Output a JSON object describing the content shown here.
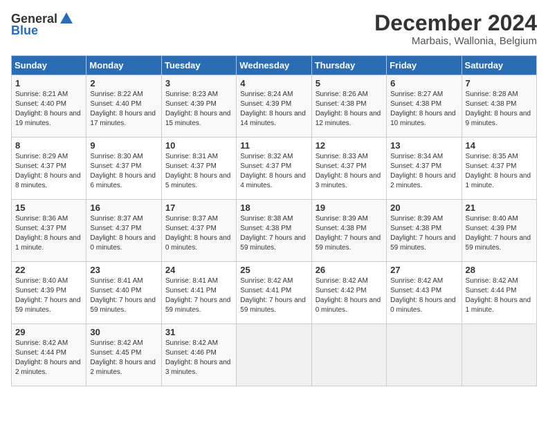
{
  "logo": {
    "general": "General",
    "blue": "Blue"
  },
  "title": "December 2024",
  "subtitle": "Marbais, Wallonia, Belgium",
  "days_of_week": [
    "Sunday",
    "Monday",
    "Tuesday",
    "Wednesday",
    "Thursday",
    "Friday",
    "Saturday"
  ],
  "weeks": [
    [
      {
        "day": "1",
        "sunrise": "8:21 AM",
        "sunset": "4:40 PM",
        "daylight": "8 hours and 19 minutes."
      },
      {
        "day": "2",
        "sunrise": "8:22 AM",
        "sunset": "4:40 PM",
        "daylight": "8 hours and 17 minutes."
      },
      {
        "day": "3",
        "sunrise": "8:23 AM",
        "sunset": "4:39 PM",
        "daylight": "8 hours and 15 minutes."
      },
      {
        "day": "4",
        "sunrise": "8:24 AM",
        "sunset": "4:39 PM",
        "daylight": "8 hours and 14 minutes."
      },
      {
        "day": "5",
        "sunrise": "8:26 AM",
        "sunset": "4:38 PM",
        "daylight": "8 hours and 12 minutes."
      },
      {
        "day": "6",
        "sunrise": "8:27 AM",
        "sunset": "4:38 PM",
        "daylight": "8 hours and 10 minutes."
      },
      {
        "day": "7",
        "sunrise": "8:28 AM",
        "sunset": "4:38 PM",
        "daylight": "8 hours and 9 minutes."
      }
    ],
    [
      {
        "day": "8",
        "sunrise": "8:29 AM",
        "sunset": "4:37 PM",
        "daylight": "8 hours and 8 minutes."
      },
      {
        "day": "9",
        "sunrise": "8:30 AM",
        "sunset": "4:37 PM",
        "daylight": "8 hours and 6 minutes."
      },
      {
        "day": "10",
        "sunrise": "8:31 AM",
        "sunset": "4:37 PM",
        "daylight": "8 hours and 5 minutes."
      },
      {
        "day": "11",
        "sunrise": "8:32 AM",
        "sunset": "4:37 PM",
        "daylight": "8 hours and 4 minutes."
      },
      {
        "day": "12",
        "sunrise": "8:33 AM",
        "sunset": "4:37 PM",
        "daylight": "8 hours and 3 minutes."
      },
      {
        "day": "13",
        "sunrise": "8:34 AM",
        "sunset": "4:37 PM",
        "daylight": "8 hours and 2 minutes."
      },
      {
        "day": "14",
        "sunrise": "8:35 AM",
        "sunset": "4:37 PM",
        "daylight": "8 hours and 1 minute."
      }
    ],
    [
      {
        "day": "15",
        "sunrise": "8:36 AM",
        "sunset": "4:37 PM",
        "daylight": "8 hours and 1 minute."
      },
      {
        "day": "16",
        "sunrise": "8:37 AM",
        "sunset": "4:37 PM",
        "daylight": "8 hours and 0 minutes."
      },
      {
        "day": "17",
        "sunrise": "8:37 AM",
        "sunset": "4:37 PM",
        "daylight": "8 hours and 0 minutes."
      },
      {
        "day": "18",
        "sunrise": "8:38 AM",
        "sunset": "4:38 PM",
        "daylight": "7 hours and 59 minutes."
      },
      {
        "day": "19",
        "sunrise": "8:39 AM",
        "sunset": "4:38 PM",
        "daylight": "7 hours and 59 minutes."
      },
      {
        "day": "20",
        "sunrise": "8:39 AM",
        "sunset": "4:38 PM",
        "daylight": "7 hours and 59 minutes."
      },
      {
        "day": "21",
        "sunrise": "8:40 AM",
        "sunset": "4:39 PM",
        "daylight": "7 hours and 59 minutes."
      }
    ],
    [
      {
        "day": "22",
        "sunrise": "8:40 AM",
        "sunset": "4:39 PM",
        "daylight": "7 hours and 59 minutes."
      },
      {
        "day": "23",
        "sunrise": "8:41 AM",
        "sunset": "4:40 PM",
        "daylight": "7 hours and 59 minutes."
      },
      {
        "day": "24",
        "sunrise": "8:41 AM",
        "sunset": "4:41 PM",
        "daylight": "7 hours and 59 minutes."
      },
      {
        "day": "25",
        "sunrise": "8:42 AM",
        "sunset": "4:41 PM",
        "daylight": "7 hours and 59 minutes."
      },
      {
        "day": "26",
        "sunrise": "8:42 AM",
        "sunset": "4:42 PM",
        "daylight": "8 hours and 0 minutes."
      },
      {
        "day": "27",
        "sunrise": "8:42 AM",
        "sunset": "4:43 PM",
        "daylight": "8 hours and 0 minutes."
      },
      {
        "day": "28",
        "sunrise": "8:42 AM",
        "sunset": "4:44 PM",
        "daylight": "8 hours and 1 minute."
      }
    ],
    [
      {
        "day": "29",
        "sunrise": "8:42 AM",
        "sunset": "4:44 PM",
        "daylight": "8 hours and 2 minutes."
      },
      {
        "day": "30",
        "sunrise": "8:42 AM",
        "sunset": "4:45 PM",
        "daylight": "8 hours and 2 minutes."
      },
      {
        "day": "31",
        "sunrise": "8:42 AM",
        "sunset": "4:46 PM",
        "daylight": "8 hours and 3 minutes."
      },
      null,
      null,
      null,
      null
    ]
  ],
  "labels": {
    "sunrise": "Sunrise:",
    "sunset": "Sunset:",
    "daylight": "Daylight:"
  }
}
